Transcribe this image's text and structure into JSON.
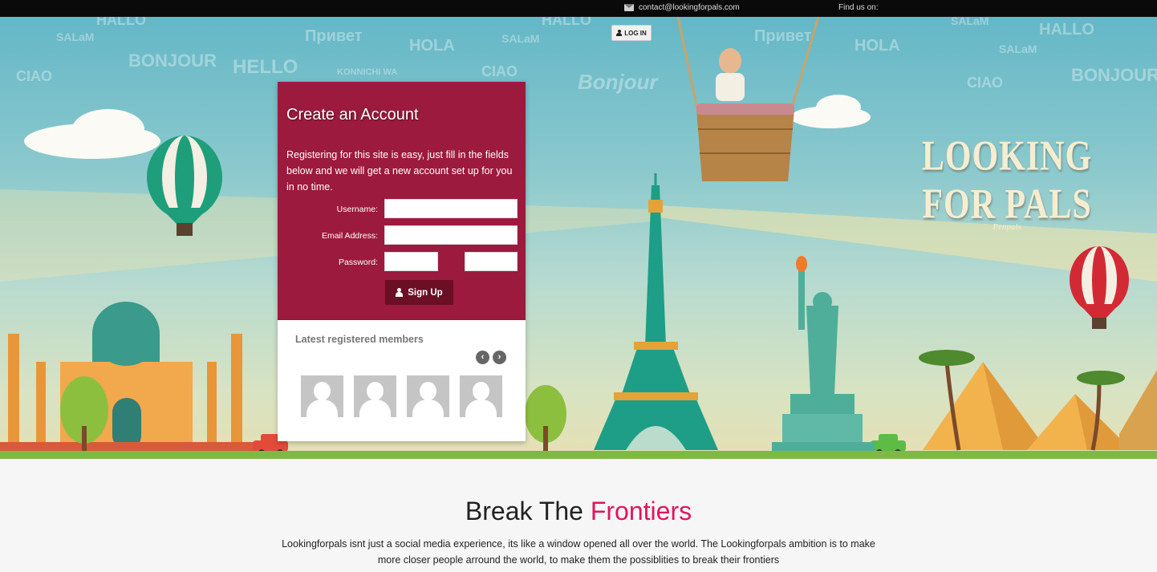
{
  "topbar": {
    "contact_email": "contact@lookingforpals.com",
    "find_us": "Find us on:"
  },
  "header": {
    "login_label": "LOG IN"
  },
  "register": {
    "title": "Create an Account",
    "intro": "Registering for this site is easy, just fill in the fields below and we will get a new account set up for you in no time.",
    "username_label": "Username:",
    "email_label": "Email Address:",
    "password_label": "Password:",
    "username_value": "",
    "email_value": "",
    "password_value": "",
    "password_confirm_value": "",
    "signup_label": "Sign Up"
  },
  "members": {
    "title": "Latest registered members",
    "prev_icon": "chevron-left-icon",
    "next_icon": "chevron-right-icon"
  },
  "logo": {
    "name": "LOOKING FOR PALS",
    "tagline": "Penpals"
  },
  "about": {
    "heading_part1": "Break The",
    "heading_part2": "Frontiers",
    "text": "Lookingforpals isnt just a social media experience, its like a window opened all over the world. The Lookingforpals ambition is to make more closer people arround the world, to make them the possiblities to break their frontiers"
  },
  "colors": {
    "brand": "#9c1a3d",
    "accent": "#e2145c",
    "button": "#6a0f24"
  }
}
